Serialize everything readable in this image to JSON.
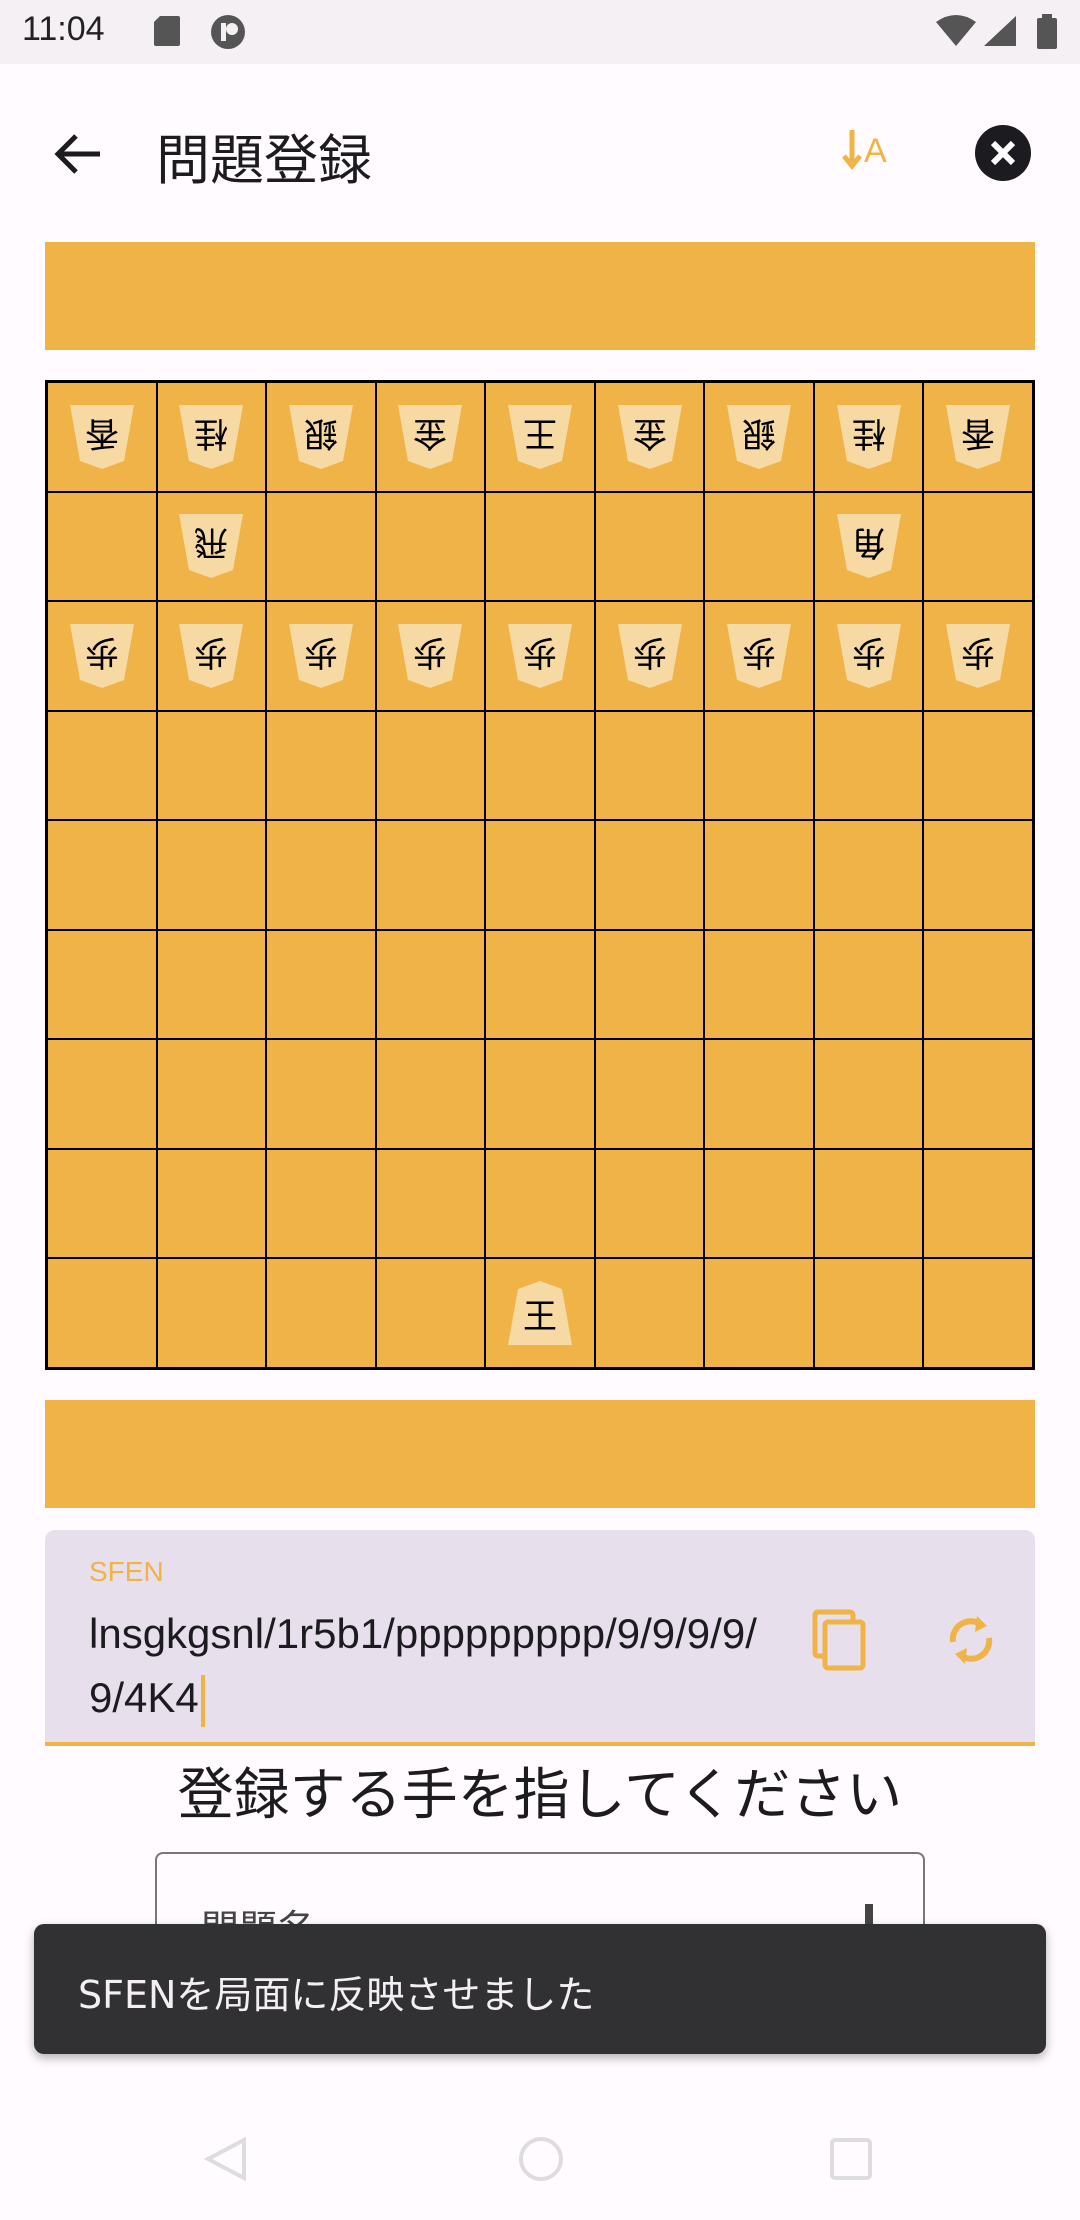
{
  "status_bar": {
    "time": "11:04",
    "left_icons": [
      "sd-card-icon",
      "app-notification-icon"
    ],
    "right_icons": [
      "wifi-icon",
      "signal-icon",
      "battery-icon"
    ]
  },
  "app_bar": {
    "title": "問題登録",
    "back_icon": "arrow-back-icon",
    "sort_icon": "sort-icon",
    "close_icon": "close-circle-icon"
  },
  "colors": {
    "board": "#efb347",
    "piece": "#f7d9a3",
    "accent": "#efb347",
    "field_bg": "#e7e0ec",
    "snackbar_bg": "#313033"
  },
  "board": {
    "rows": [
      [
        {
          "p": "香",
          "g": true
        },
        {
          "p": "桂",
          "g": true
        },
        {
          "p": "銀",
          "g": true
        },
        {
          "p": "金",
          "g": true
        },
        {
          "p": "王",
          "g": true
        },
        {
          "p": "金",
          "g": true
        },
        {
          "p": "銀",
          "g": true
        },
        {
          "p": "桂",
          "g": true
        },
        {
          "p": "香",
          "g": true
        }
      ],
      [
        null,
        {
          "p": "飛",
          "g": true
        },
        null,
        null,
        null,
        null,
        null,
        {
          "p": "角",
          "g": true
        },
        null
      ],
      [
        {
          "p": "歩",
          "g": true
        },
        {
          "p": "歩",
          "g": true
        },
        {
          "p": "歩",
          "g": true
        },
        {
          "p": "歩",
          "g": true
        },
        {
          "p": "歩",
          "g": true
        },
        {
          "p": "歩",
          "g": true
        },
        {
          "p": "歩",
          "g": true
        },
        {
          "p": "歩",
          "g": true
        },
        {
          "p": "歩",
          "g": true
        }
      ],
      [
        null,
        null,
        null,
        null,
        null,
        null,
        null,
        null,
        null
      ],
      [
        null,
        null,
        null,
        null,
        null,
        null,
        null,
        null,
        null
      ],
      [
        null,
        null,
        null,
        null,
        null,
        null,
        null,
        null,
        null
      ],
      [
        null,
        null,
        null,
        null,
        null,
        null,
        null,
        null,
        null
      ],
      [
        null,
        null,
        null,
        null,
        null,
        null,
        null,
        null,
        null
      ],
      [
        null,
        null,
        null,
        null,
        {
          "p": "王",
          "g": false
        },
        null,
        null,
        null,
        null
      ]
    ]
  },
  "sfen": {
    "label": "SFEN",
    "value": "lnsgkgsnl/1r5b1/ppppppppp/9/9/9/9/9/4K4",
    "copy_icon": "copy-icon",
    "sync_icon": "sync-icon"
  },
  "instruction": "登録する手を指してください",
  "name_field": {
    "placeholder": "問題名"
  },
  "snackbar": {
    "message": "SFENを局面に反映させました"
  },
  "nav_bar": {
    "icons": [
      "nav-back-icon",
      "nav-home-icon",
      "nav-recents-icon"
    ]
  }
}
